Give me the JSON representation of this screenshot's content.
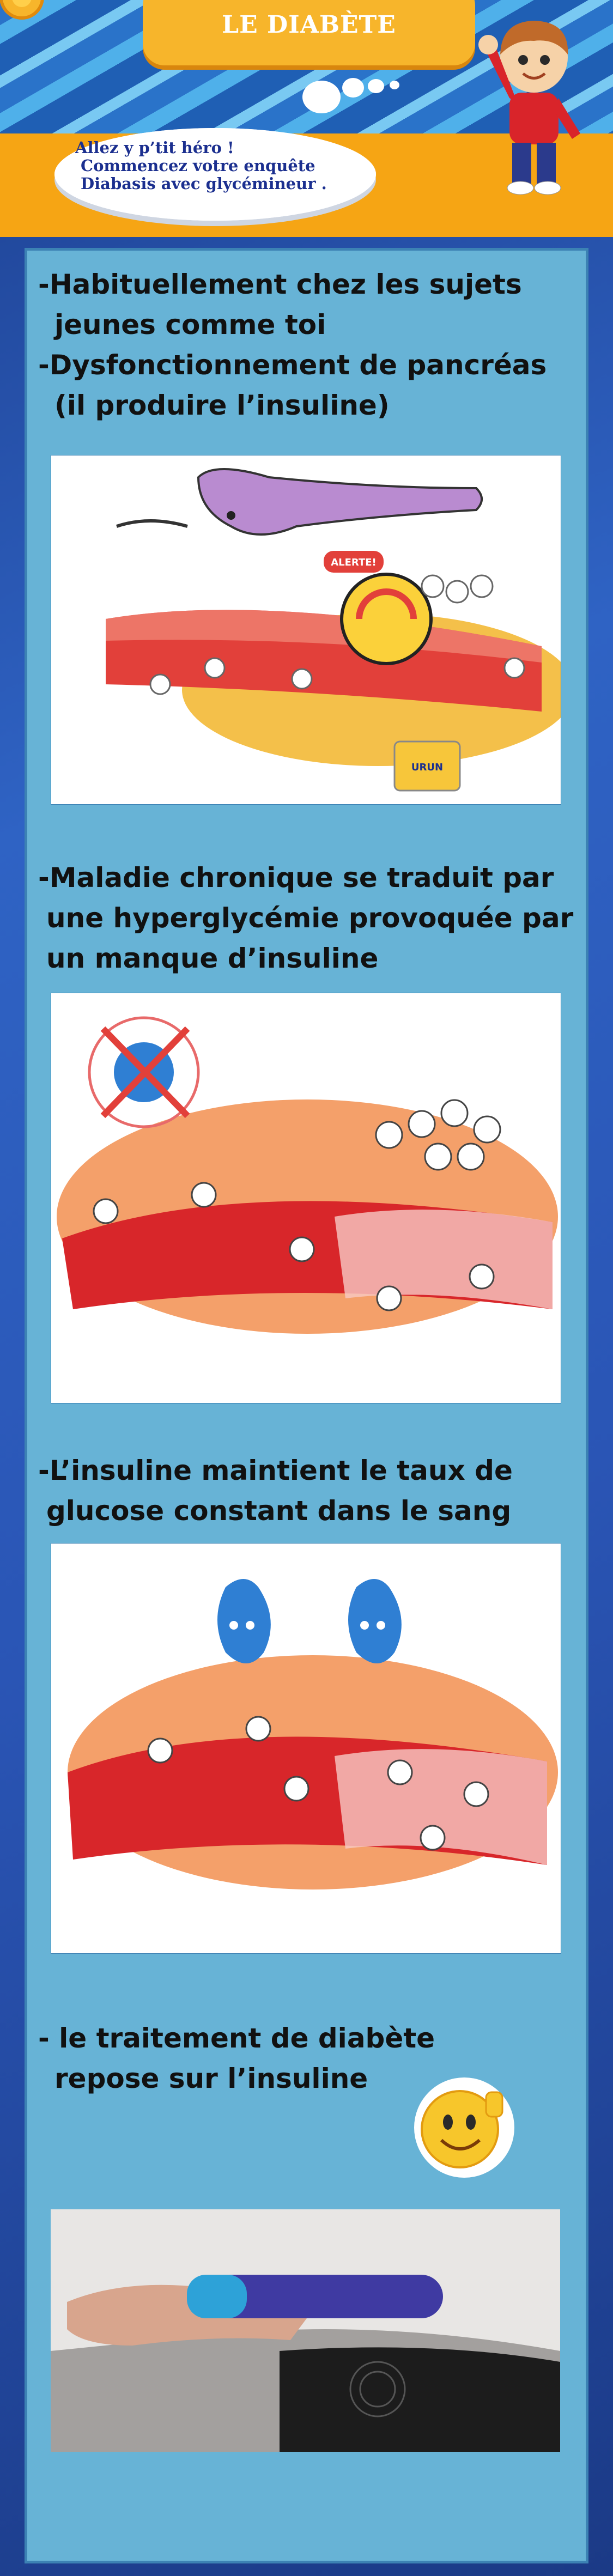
{
  "header": {
    "title": "LE DIABÈTE",
    "bubble_lines": [
      "Allez y p’tit héro !",
      "Commencez votre enquête",
      "Diabasis avec glycémineur ."
    ]
  },
  "sections": [
    {
      "lines": [
        "-Habituellement chez les sujets",
        "jeunes comme toi",
        "-Dysfonctionnement de pancréas",
        "(il produire l’insuline)"
      ],
      "illustration": {
        "alert_label": "ALERTE!",
        "jar_label": "URUN"
      }
    },
    {
      "lines": [
        "-Maladie chronique se traduit par",
        "une hyperglycémie provoquée par",
        "un manque d’insuline"
      ]
    },
    {
      "lines": [
        "-L’insuline maintient le taux de",
        "glucose constant dans le sang"
      ]
    },
    {
      "lines": [
        "- le traitement de diabète",
        "repose sur l’insuline"
      ]
    }
  ],
  "colors": {
    "background": "#2f63c4",
    "panel": "#67b3d6",
    "orange": "#f6a514",
    "title_box": "#f7b52b",
    "text": "#111111"
  }
}
